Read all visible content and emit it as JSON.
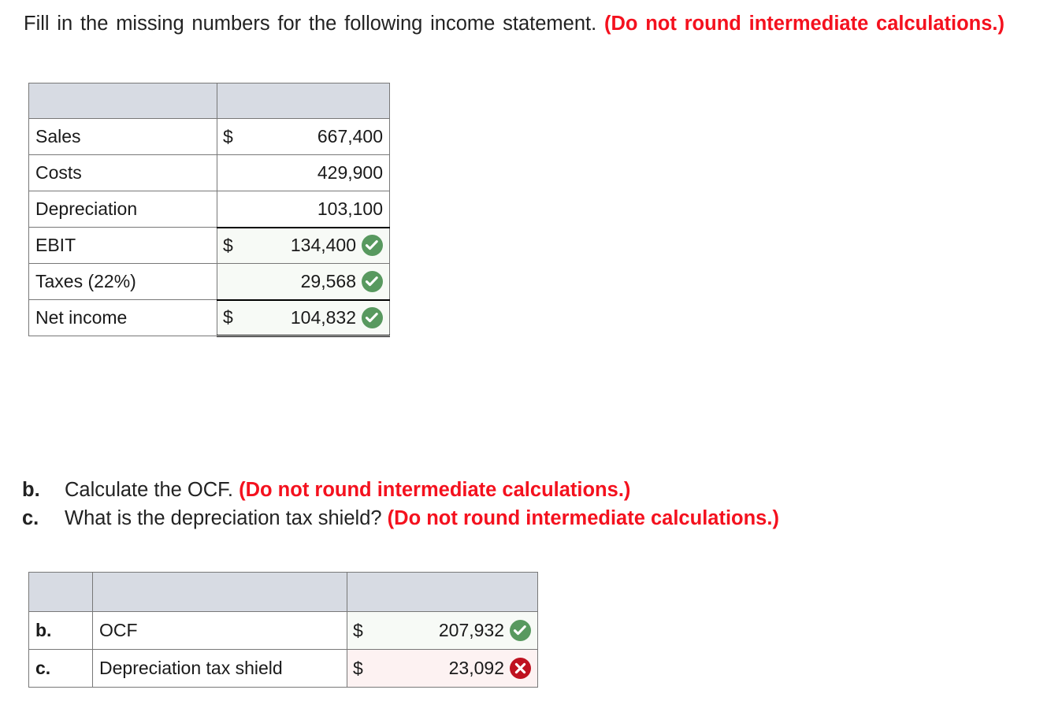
{
  "prompt": {
    "text_plain": "Fill in the missing numbers for the following income statement.",
    "text_red": "(Do not round intermediate calculations.)"
  },
  "income_table": {
    "header": "",
    "rows": [
      {
        "label": "Sales",
        "currency": "$",
        "value": "667,400",
        "status": "none"
      },
      {
        "label": "Costs",
        "currency": "",
        "value": "429,900",
        "status": "none"
      },
      {
        "label": "Depreciation",
        "currency": "",
        "value": "103,100",
        "status": "none"
      },
      {
        "label": "EBIT",
        "currency": "$",
        "value": "134,400",
        "status": "correct"
      },
      {
        "label": "Taxes (22%)",
        "currency": "",
        "value": "29,568",
        "status": "correct"
      },
      {
        "label": "Net income",
        "currency": "$",
        "value": "104,832",
        "status": "correct"
      }
    ]
  },
  "questions": [
    {
      "marker": "b.",
      "text_plain": "Calculate the OCF.",
      "text_red": "(Do not round intermediate calculations.)"
    },
    {
      "marker": "c.",
      "text_plain": "What is the depreciation tax shield?",
      "text_red": "(Do not round intermediate calculations.)"
    }
  ],
  "answers_table": {
    "header": "",
    "rows": [
      {
        "key": "b.",
        "label": "OCF",
        "currency": "$",
        "value": "207,932",
        "status": "correct"
      },
      {
        "key": "c.",
        "label": "Depreciation tax shield",
        "currency": "$",
        "value": "23,092",
        "status": "incorrect"
      }
    ]
  },
  "colors": {
    "header_fill": "#d7dbe3",
    "correct_green": "#58995f",
    "incorrect_red": "#bf1220",
    "prompt_red": "#f4111e",
    "correct_cell_fill": "#f7faf6",
    "incorrect_cell_fill": "#fdf2f2",
    "border": "#787878"
  },
  "icons": {
    "correct": "check-circle-icon",
    "incorrect": "x-circle-icon"
  }
}
